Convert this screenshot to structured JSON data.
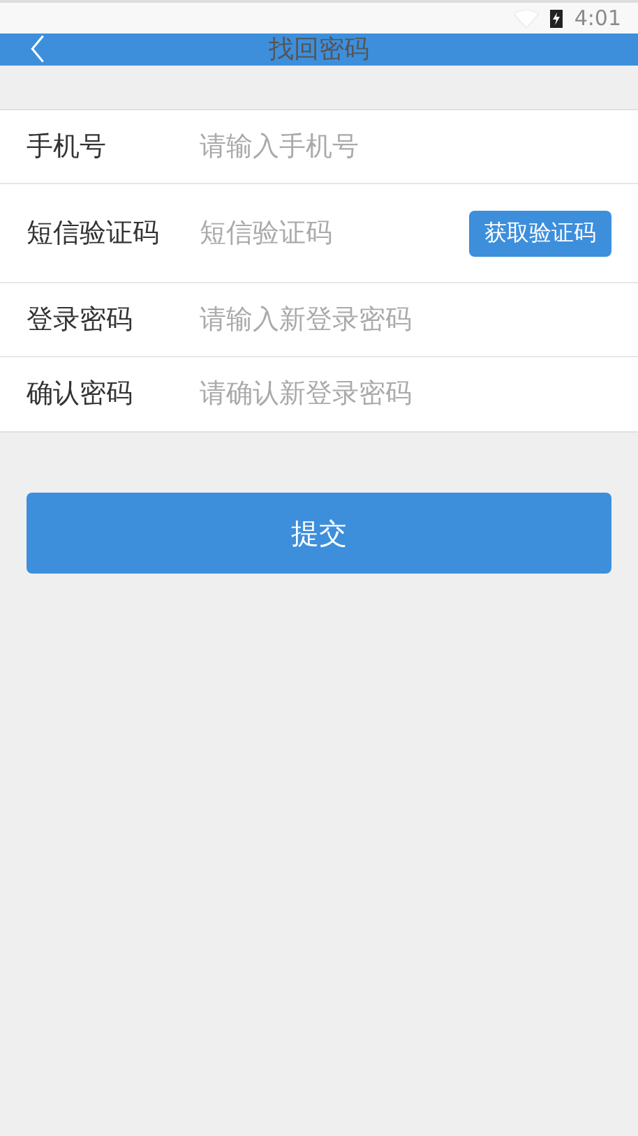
{
  "status_bar": {
    "time": "4:01"
  },
  "header": {
    "title": "找回密码"
  },
  "form": {
    "rows": [
      {
        "kind": "input",
        "label": "手机号",
        "placeholder": "请输入手机号"
      },
      {
        "kind": "code",
        "label": "短信验证码",
        "placeholder": "短信验证码",
        "button": "获取验证码"
      },
      {
        "kind": "input",
        "label": "登录密码",
        "placeholder": "请输入新登录密码"
      },
      {
        "kind": "input",
        "label": "确认密码",
        "placeholder": "请确认新登录密码"
      }
    ]
  },
  "submit": "提交"
}
